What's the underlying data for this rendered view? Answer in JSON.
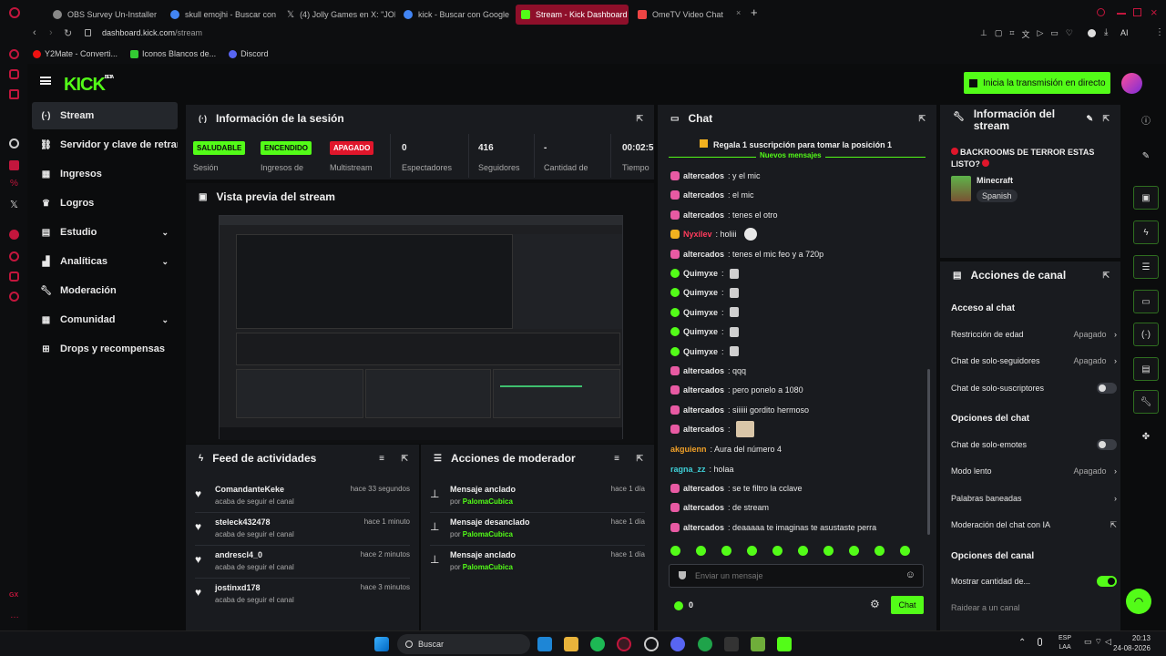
{
  "browser": {
    "tabs": [
      {
        "label": "OBS Survey Un-Installer"
      },
      {
        "label": "skull emojhi - Buscar con G"
      },
      {
        "label": "(4) Jolly Games en X: \"JOL"
      },
      {
        "label": "kick - Buscar con Google"
      },
      {
        "label": "Stream - Kick Dashboard"
      },
      {
        "label": "OmeTV Video Chat"
      }
    ],
    "url_host": "dashboard.kick.com",
    "url_path": "/stream",
    "bookmarks": [
      {
        "label": "Y2Mate - Converti..."
      },
      {
        "label": "Iconos Blancos de..."
      },
      {
        "label": "Discord"
      }
    ],
    "ai_label": "AI"
  },
  "app": {
    "beta": "BETA",
    "go_live": "Inicia la transmisión en directo"
  },
  "sidebar": {
    "items": [
      {
        "label": "Stream"
      },
      {
        "label": "Servidor y clave de retransmisión"
      },
      {
        "label": "Ingresos"
      },
      {
        "label": "Logros"
      },
      {
        "label": "Estudio"
      },
      {
        "label": "Analíticas"
      },
      {
        "label": "Moderación"
      },
      {
        "label": "Comunidad"
      },
      {
        "label": "Drops y recompensas"
      }
    ]
  },
  "session": {
    "title": "Información de la sesión",
    "stats": [
      {
        "badge": "SALUDABLE",
        "label": "Sesión"
      },
      {
        "badge": "ENCENDIDO",
        "label": "Ingresos de"
      },
      {
        "badge": "APAGADO",
        "label": "Multistream"
      },
      {
        "value": "0",
        "label": "Espectadores"
      },
      {
        "value": "416",
        "label": "Seguidores"
      },
      {
        "value": "-",
        "label": "Cantidad de"
      },
      {
        "value": "00:02:5",
        "label": "Tiempo"
      }
    ]
  },
  "preview": {
    "title": "Vista previa del stream"
  },
  "feed": {
    "title": "Feed de actividades",
    "items": [
      {
        "name": "ComandanteKeke",
        "sub": "acaba de seguir el canal",
        "time": "hace 33 segundos"
      },
      {
        "name": "steleck432478",
        "sub": "acaba de seguir el canal",
        "time": "hace 1 minuto"
      },
      {
        "name": "andrescl4_0",
        "sub": "acaba de seguir el canal",
        "time": "hace 2 minutos"
      },
      {
        "name": "jostinxd178",
        "sub": "acaba de seguir el canal",
        "time": "hace 3 minutos"
      }
    ]
  },
  "modactions": {
    "title": "Acciones de moderador",
    "items": [
      {
        "action": "Mensaje anclado",
        "by_prefix": "por",
        "by": "PalomaCubica",
        "time": "hace 1 día"
      },
      {
        "action": "Mensaje desanclado",
        "by_prefix": "por",
        "by": "PalomaCubica",
        "time": "hace 1 día"
      },
      {
        "action": "Mensaje anclado",
        "by_prefix": "por",
        "by": "PalomaCubica",
        "time": "hace 1 día"
      }
    ]
  },
  "chat": {
    "title": "Chat",
    "sub_promo": "Regala 1 suscripción para tomar la posición 1",
    "new_messages": "Nuevos mensajes",
    "messages": [
      {
        "user": "altercados",
        "text": ": y el mic",
        "color": "#e6e6e6"
      },
      {
        "user": "altercados",
        "text": ": el mic",
        "color": "#e6e6e6"
      },
      {
        "user": "altercados",
        "text": ": tenes el otro",
        "color": "#e6e6e6"
      },
      {
        "user": "Nyxilev",
        "text": ": holiii",
        "color": "#ff3b5c"
      },
      {
        "user": "altercados",
        "text": ": tenes el mic feo y a 720p",
        "color": "#e6e6e6"
      },
      {
        "user": "Quimyxe",
        "text": ":",
        "color": "#e6e6e6"
      },
      {
        "user": "Quimyxe",
        "text": ":",
        "color": "#e6e6e6"
      },
      {
        "user": "Quimyxe",
        "text": ":",
        "color": "#e6e6e6"
      },
      {
        "user": "Quimyxe",
        "text": ":",
        "color": "#e6e6e6"
      },
      {
        "user": "Quimyxe",
        "text": ":",
        "color": "#e6e6e6"
      },
      {
        "user": "altercados",
        "text": ": qqq",
        "color": "#e6e6e6"
      },
      {
        "user": "altercados",
        "text": ": pero ponelo a 1080",
        "color": "#e6e6e6"
      },
      {
        "user": "altercados",
        "text": ": siiiiii gordito hermoso",
        "color": "#e6e6e6"
      },
      {
        "user": "altercados",
        "text": ":",
        "color": "#e6e6e6"
      },
      {
        "user": "akguienn",
        "text": ": Aura del número 4",
        "color": "#f0a028"
      },
      {
        "user": "ragna_zz",
        "text": ": holaa",
        "color": "#3fd0d8"
      },
      {
        "user": "altercados",
        "text": ": se te filtro la cclave",
        "color": "#e6e6e6"
      },
      {
        "user": "altercados",
        "text": ": de stream",
        "color": "#e6e6e6"
      },
      {
        "user": "altercados",
        "text": ": deaaaaa te imaginas te asustaste perra",
        "color": "#e6e6e6"
      }
    ],
    "input_placeholder": "Enviar un mensaje",
    "count": "0",
    "send": "Chat"
  },
  "stream_info": {
    "title": "Información del stream",
    "stream_title": "BACKROOMS DE TERROR ESTAS LISTO?",
    "category": "Minecraft",
    "language": "Spanish"
  },
  "channel_actions": {
    "title": "Acciones de canal",
    "chat_access": "Acceso al chat",
    "age_restriction": "Restricción de edad",
    "age_value": "Apagado",
    "followers_only": "Chat de solo-seguidores",
    "followers_value": "Apagado",
    "subs_only": "Chat de solo-suscriptores",
    "chat_options": "Opciones del chat",
    "emotes_only": "Chat de solo-emotes",
    "slow_mode": "Modo lento",
    "slow_value": "Apagado",
    "banned_words": "Palabras baneadas",
    "ai_moderation": "Moderación del chat con IA",
    "channel_options": "Opciones del canal",
    "show_count": "Mostrar cantidad de...",
    "raid": "Raidear a un canal"
  },
  "taskbar": {
    "search": "Buscar",
    "lang": "ESP",
    "region": "LAA",
    "time": "20:13",
    "date": "24-08-2026"
  },
  "colors": {
    "accent": "#53fc18",
    "panel": "#191b1f",
    "bg": "#0b0c0d",
    "brand_red": "#c3163d"
  }
}
